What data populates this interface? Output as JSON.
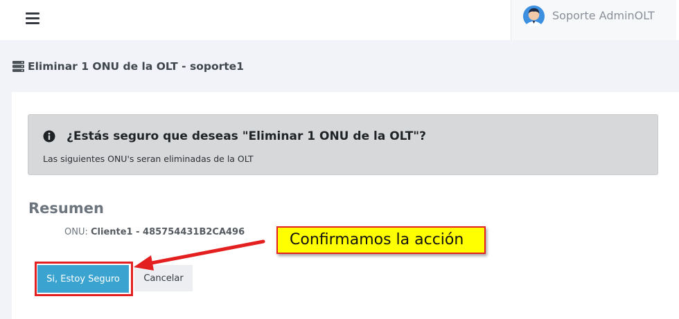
{
  "header": {
    "menu_icon": "hamburger-icon",
    "user_avatar_icon": "user-avatar-icon",
    "user_name": "Soporte AdminOLT"
  },
  "page": {
    "title_icon": "database-icon",
    "title": "Eliminar 1 ONU de la OLT - soporte1"
  },
  "alert": {
    "icon": "info-circle-icon",
    "title": "¿Estás seguro que deseas \"Eliminar 1 ONU de la OLT\"?",
    "body": "Las siguientes ONU's seran eliminadas de la OLT"
  },
  "summary": {
    "heading": "Resumen",
    "onu_label": "ONU:",
    "onu_value": "Cliente1 - 485754431B2CA496"
  },
  "actions": {
    "confirm_label": "Si, Estoy Seguro",
    "cancel_label": "Cancelar"
  },
  "annotation": {
    "callout_text": "Confirmamos la acción",
    "color_highlight": "#ffff00",
    "color_marker": "#e41f1f"
  },
  "colors": {
    "primary": "#3aa3cf",
    "background": "#f1f3f8",
    "alert_background": "#d7d8da"
  }
}
